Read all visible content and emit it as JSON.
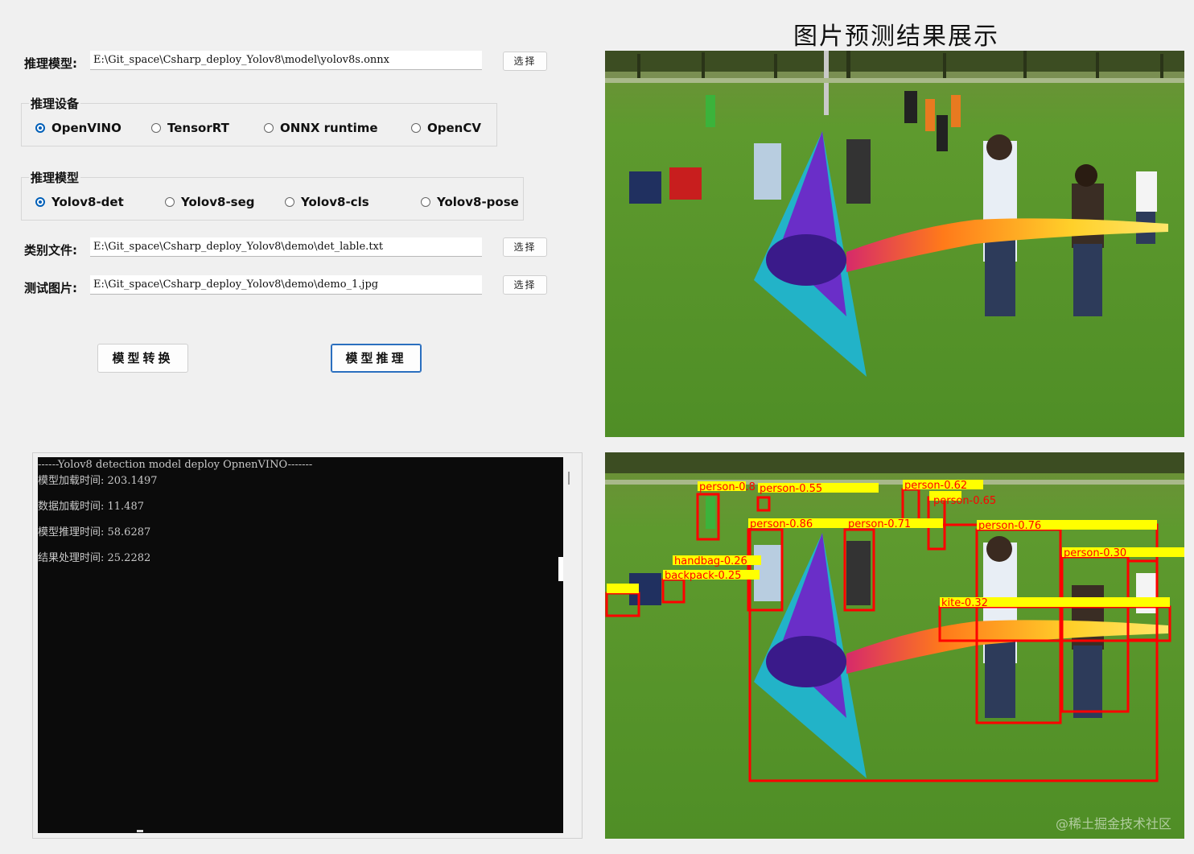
{
  "form": {
    "model_label": "推理模型:",
    "model_path": "E:\\Git_space\\Csharp_deploy_Yolov8\\model\\yolov8s.onnx",
    "class_label": "类别文件:",
    "class_path": "E:\\Git_space\\Csharp_deploy_Yolov8\\demo\\det_lable.txt",
    "image_label": "测试图片:",
    "image_path": "E:\\Git_space\\Csharp_deploy_Yolov8\\demo\\demo_1.jpg",
    "select_label": "选择"
  },
  "device_group": {
    "title": "推理设备",
    "options": [
      "OpenVINO",
      "TensorRT",
      "ONNX runtime",
      "OpenCV"
    ],
    "selected": "OpenVINO"
  },
  "model_group": {
    "title": "推理模型",
    "options": [
      "Yolov8-det",
      "Yolov8-seg",
      "Yolov8-cls",
      "Yolov8-pose"
    ],
    "selected": "Yolov8-det"
  },
  "actions": {
    "convert_label": "模型转换",
    "infer_label": "模型推理"
  },
  "console": {
    "lines": [
      "------Yolov8 detection model deploy OpnenVINO-------",
      "模型加载时间: 203.1497",
      "数据加载时间: 11.487",
      "模型推理时间: 58.6287",
      "结果处理时间: 25.2282"
    ]
  },
  "result": {
    "title": "图片预测结果展示",
    "detections": [
      "person-0.8",
      "person-0.65",
      "person-0.76",
      "person-0.86",
      "person-0.71",
      "kite-0.32",
      "backpack-0.25",
      "handbag-0.26",
      "person-0.30",
      "person-0.55",
      "person-0.62"
    ],
    "watermark": "@稀土掘金技术社区"
  },
  "colors": {
    "accent": "#005fb8",
    "box": "#ff0000",
    "label_bg": "#ffff00",
    "grass": "#5c9a32"
  }
}
